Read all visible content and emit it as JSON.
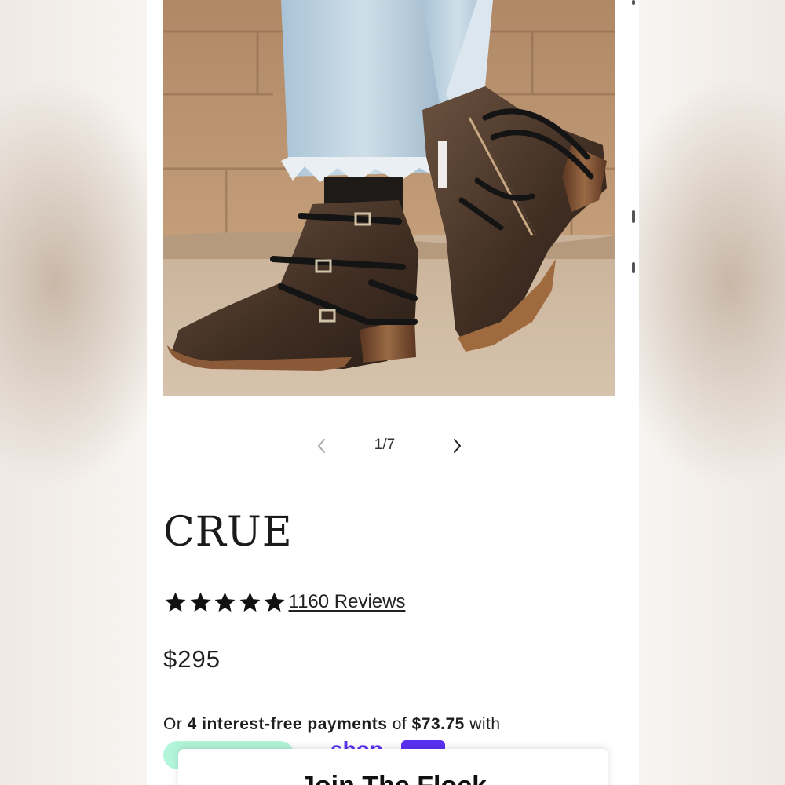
{
  "product": {
    "image_counter": "1/7",
    "title": "CRUE",
    "rating_value": 5,
    "rating_max": 5,
    "reviews_label": "1160 Reviews",
    "price": "$295"
  },
  "payments": {
    "text_before": "Or ",
    "count_text": "4 interest-free payments",
    "text_middle": " of ",
    "amount": "$73.75",
    "text_after": " with",
    "shop_pay_word": "shop"
  },
  "popup": {
    "title": "Join The Flock"
  },
  "colors": {
    "star": "#111111",
    "afterpay_badge": "#b2f5da",
    "shop_pay": "#5a31f4"
  }
}
